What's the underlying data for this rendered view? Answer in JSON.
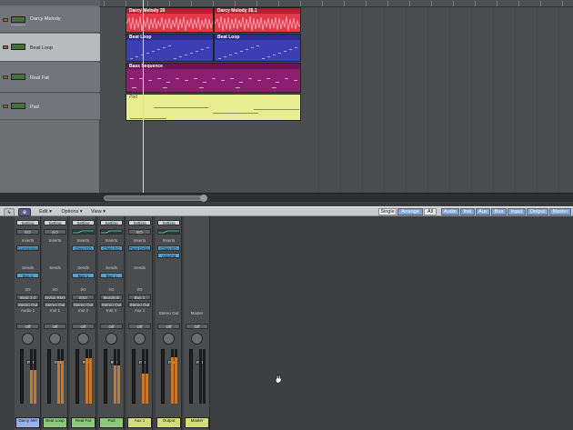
{
  "tracks": [
    {
      "name": "Darcy Melody",
      "color": "#e03040"
    },
    {
      "name": "Beat Loop",
      "color": "#3a3ab0"
    },
    {
      "name": "Real Fat",
      "color": "#8a1a6a"
    },
    {
      "name": "Pad",
      "color": "#e6ec8c"
    }
  ],
  "regions": {
    "darcy1": "Darcy Melody 26",
    "darcy2": "Darcy Melody 26.1",
    "beat1": "Beat Loop",
    "beat2": "Beat Loop",
    "bass": "Bass Sequence",
    "pad": "Pad"
  },
  "mixer_toolbar": {
    "edit": "Edit",
    "options": "Options",
    "view": "View",
    "modes": [
      "Single",
      "Arrange",
      "All"
    ],
    "filters": [
      "Audio",
      "Inst",
      "Aux",
      "Bus",
      "Input",
      "Output",
      "Master"
    ]
  },
  "strips": [
    {
      "setting": "Setting",
      "eq": "EQ",
      "insert": "Compressor",
      "send": "Bus 1",
      "io": "Input 1-2",
      "out": "Stereo Out",
      "group": "Audio 1",
      "value": "0.0",
      "name": "Darcy Mel",
      "np_color": "#9ab0e8"
    },
    {
      "setting": "Setting",
      "eq": "EQ",
      "insert": "",
      "send": "",
      "io": "Stylus RMX",
      "out": "Stereo Out",
      "group": "Inst 1",
      "value": "0.0",
      "name": "Beat Loop",
      "np_color": "#8cc87c"
    },
    {
      "setting": "Setting",
      "eq": "",
      "insert": "Chan EQ",
      "send": "Bus 1",
      "io": "ES2",
      "out": "Stereo Out",
      "group": "Inst 2",
      "value": "-1.0",
      "name": "Real Fat",
      "np_color": "#8cc87c"
    },
    {
      "setting": "Setting",
      "eq": "",
      "insert": "Chan EQ",
      "send": "Bus 1",
      "io": "Morphoh",
      "out": "Stereo Out",
      "group": "Inst 3",
      "value": "-1.0",
      "name": "Pad",
      "np_color": "#8cc87c"
    },
    {
      "setting": "Setting",
      "eq": "EQ",
      "insert": "Tape Delay",
      "send": "",
      "io": "Bus 1",
      "out": "Stereo Out",
      "group": "Aux 1",
      "value": "0.0",
      "name": "Aux 1",
      "np_color": "#d4dc7c"
    },
    {
      "setting": "Setting",
      "eq": "",
      "insert": "Chan EQ",
      "send": "",
      "io": "",
      "out": "",
      "group": "Stereo Out",
      "value": "0.0",
      "name": "Output",
      "np_color": "#d4dc7c"
    },
    {
      "setting": "",
      "eq": "",
      "insert": "",
      "send": "",
      "io": "",
      "out": "",
      "group": "Master",
      "value": "0.0",
      "name": "Master",
      "np_color": "#d4dc7c"
    }
  ],
  "labels": {
    "inserts": "Inserts",
    "sends": "Sends",
    "io": "I/O",
    "off": "Off"
  },
  "extra": {
    "adlimit": "AdLimit"
  }
}
